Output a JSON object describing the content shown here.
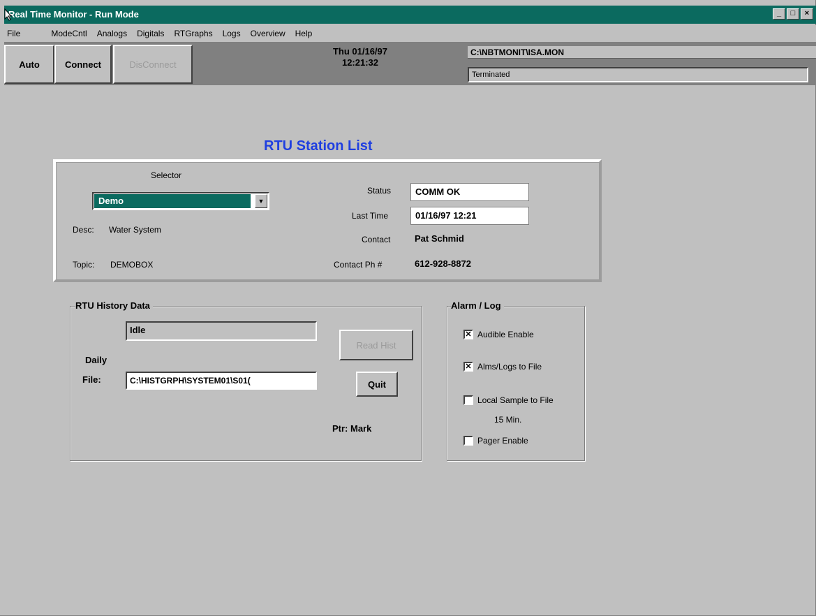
{
  "window": {
    "title": "Real Time Monitor - Run Mode",
    "buttons": [
      "_",
      "□",
      "×"
    ]
  },
  "menu": [
    "File",
    "ModeCntl",
    "Analogs",
    "Digitals",
    "RTGraphs",
    "Logs",
    "Overview",
    "Help"
  ],
  "toolbar": {
    "auto_label": "Auto",
    "connect_label": "Connect",
    "disconnect_label": "DisConnect",
    "date": "Thu 01/16/97",
    "time": "12:21:32",
    "file_path": "C:\\NBTMONIT\\ISA.MON",
    "status": "Terminated"
  },
  "station": {
    "title": "RTU Station List",
    "selector_label": "Selector",
    "selected": "Demo",
    "desc_label": "Desc:",
    "desc_value": "Water System",
    "topic_label": "Topic:",
    "topic_value": "DEMOBOX",
    "status_label": "Status",
    "status_value": "COMM OK",
    "last_time_label": "Last Time",
    "last_time_value": "01/16/97 12:21",
    "contact_label": "Contact",
    "contact_value": "Pat Schmid",
    "contact_ph_label": "Contact Ph #",
    "contact_ph_value": "612-928-8872"
  },
  "history": {
    "title": "RTU History Data",
    "state": "Idle",
    "daily_label": "Daily",
    "file_label": "File:",
    "file_value": "C:\\HISTGRPH\\SYSTEM01\\S01(",
    "read_hist_label": "Read Hist",
    "quit_label": "Quit",
    "ptr_label": "Ptr: Mark"
  },
  "alarm": {
    "title": "Alarm / Log",
    "items": [
      {
        "label": "Audible Enable",
        "checked": true
      },
      {
        "label": "Alms/Logs to File",
        "checked": true
      },
      {
        "label": "Local Sample to File",
        "checked": false
      },
      {
        "label": "Pager Enable",
        "checked": false
      }
    ],
    "interval": "15 Min."
  }
}
